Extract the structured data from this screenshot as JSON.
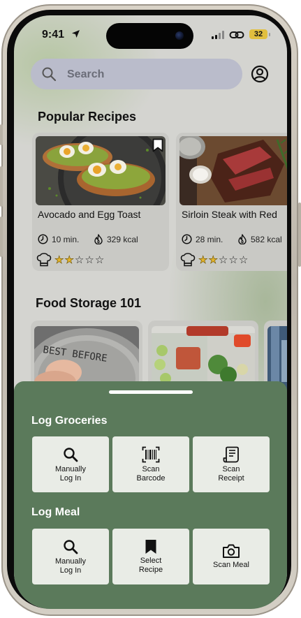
{
  "status_bar": {
    "time": "9:41",
    "battery": "32"
  },
  "search": {
    "placeholder": "Search"
  },
  "popular": {
    "title": "Popular Recipes",
    "recipes": [
      {
        "name": "Avocado and Egg Toast",
        "time": "10 min.",
        "calories": "329 kcal",
        "rating": 2,
        "max_rating": 5
      },
      {
        "name": "Sirloin Steak with Red",
        "time": "28 min.",
        "calories": "582 kcal",
        "rating": 2,
        "max_rating": 5
      }
    ]
  },
  "storage": {
    "title": "Food Storage 101",
    "label_text": "BEST BEFORE"
  },
  "sheet": {
    "log_groceries": {
      "title": "Log Groceries",
      "actions": [
        {
          "label": "Manually\nLog In",
          "icon": "search-icon"
        },
        {
          "label": "Scan\nBarcode",
          "icon": "barcode-icon"
        },
        {
          "label": "Scan\nReceipt",
          "icon": "receipt-icon"
        }
      ]
    },
    "log_meal": {
      "title": "Log Meal",
      "actions": [
        {
          "label": "Manually\nLog In",
          "icon": "search-icon"
        },
        {
          "label": "Select\nRecipe",
          "icon": "bookmark-icon"
        },
        {
          "label": "Scan Meal",
          "icon": "camera-icon"
        }
      ]
    }
  },
  "colors": {
    "sheet_bg": "#5b7a5b",
    "tile_bg": "#e9ece6",
    "search_bg": "#babccb",
    "star_filled": "#e3b32b",
    "battery": "#e1bf3f"
  }
}
